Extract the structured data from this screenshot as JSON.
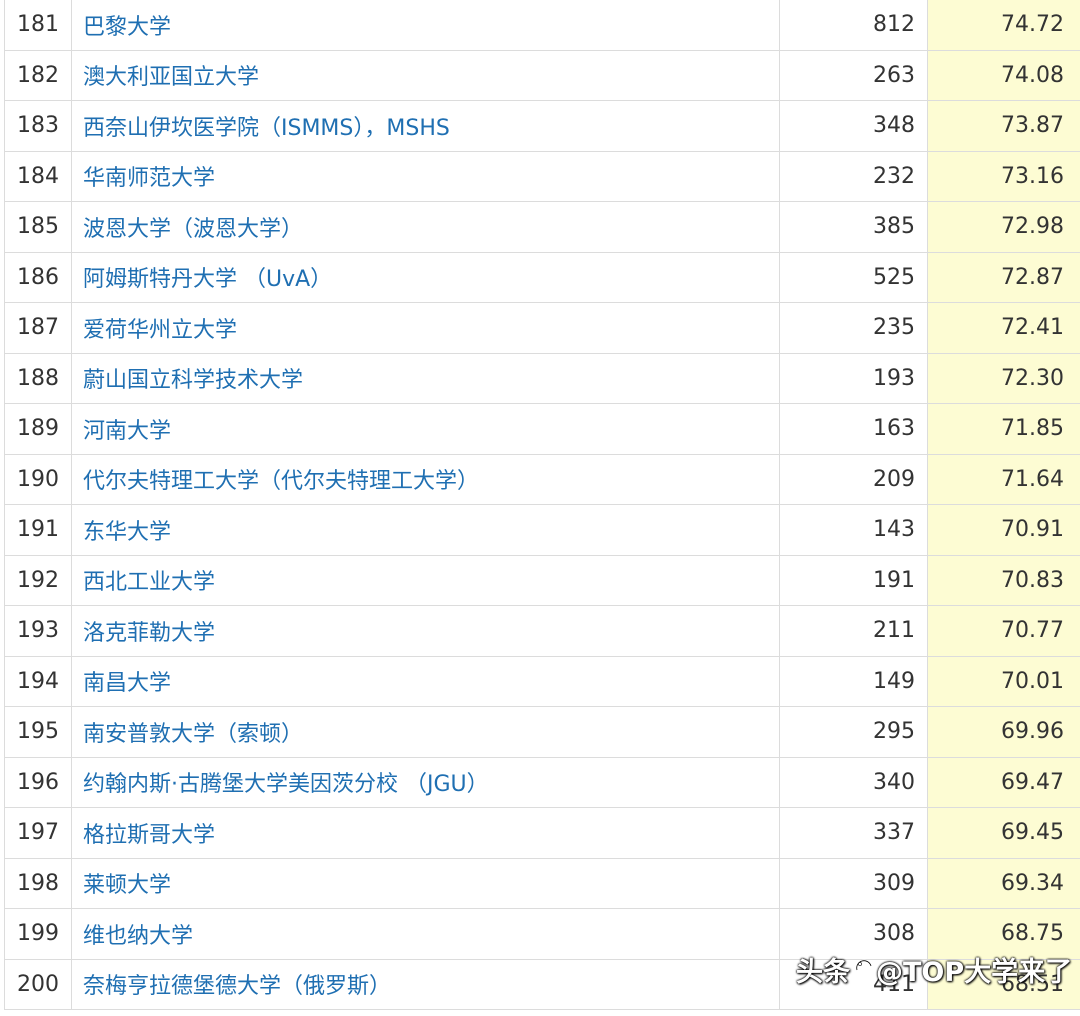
{
  "rows": [
    {
      "rank": "181",
      "name": "巴黎大学",
      "count": "812",
      "score": "74.72"
    },
    {
      "rank": "182",
      "name": "澳大利亚国立大学",
      "count": "263",
      "score": "74.08"
    },
    {
      "rank": "183",
      "name": "西奈山伊坎医学院（ISMMS），MSHS",
      "count": "348",
      "score": "73.87"
    },
    {
      "rank": "184",
      "name": "华南师范大学",
      "count": "232",
      "score": "73.16"
    },
    {
      "rank": "185",
      "name": "波恩大学（波恩大学）",
      "count": "385",
      "score": "72.98"
    },
    {
      "rank": "186",
      "name": "阿姆斯特丹大学 （UvA）",
      "count": "525",
      "score": "72.87"
    },
    {
      "rank": "187",
      "name": "爱荷华州立大学",
      "count": "235",
      "score": "72.41"
    },
    {
      "rank": "188",
      "name": "蔚山国立科学技术大学",
      "count": "193",
      "score": "72.30"
    },
    {
      "rank": "189",
      "name": "河南大学",
      "count": "163",
      "score": "71.85"
    },
    {
      "rank": "190",
      "name": "代尔夫特理工大学（代尔夫特理工大学）",
      "count": "209",
      "score": "71.64"
    },
    {
      "rank": "191",
      "name": "东华大学",
      "count": "143",
      "score": "70.91"
    },
    {
      "rank": "192",
      "name": "西北工业大学",
      "count": "191",
      "score": "70.83"
    },
    {
      "rank": "193",
      "name": "洛克菲勒大学",
      "count": "211",
      "score": "70.77"
    },
    {
      "rank": "194",
      "name": "南昌大学",
      "count": "149",
      "score": "70.01"
    },
    {
      "rank": "195",
      "name": "南安普敦大学（索顿）",
      "count": "295",
      "score": "69.96"
    },
    {
      "rank": "196",
      "name": "约翰内斯·古腾堡大学美因茨分校 （JGU）",
      "count": "340",
      "score": "69.47"
    },
    {
      "rank": "197",
      "name": "格拉斯哥大学",
      "count": "337",
      "score": "69.45"
    },
    {
      "rank": "198",
      "name": "莱顿大学",
      "count": "309",
      "score": "69.34"
    },
    {
      "rank": "199",
      "name": "维也纳大学",
      "count": "308",
      "score": "68.75"
    },
    {
      "rank": "200",
      "name": "奈梅亨拉德堡德大学（俄罗斯）",
      "count": "411",
      "score": "68.51"
    }
  ],
  "watermark": {
    "prefix": "头条",
    "handle": "@TOP大学来了"
  },
  "colors": {
    "link": "#1f6fb2",
    "score_bg": "#fdfcd3",
    "border": "#dcdcdc",
    "text": "#333333"
  }
}
